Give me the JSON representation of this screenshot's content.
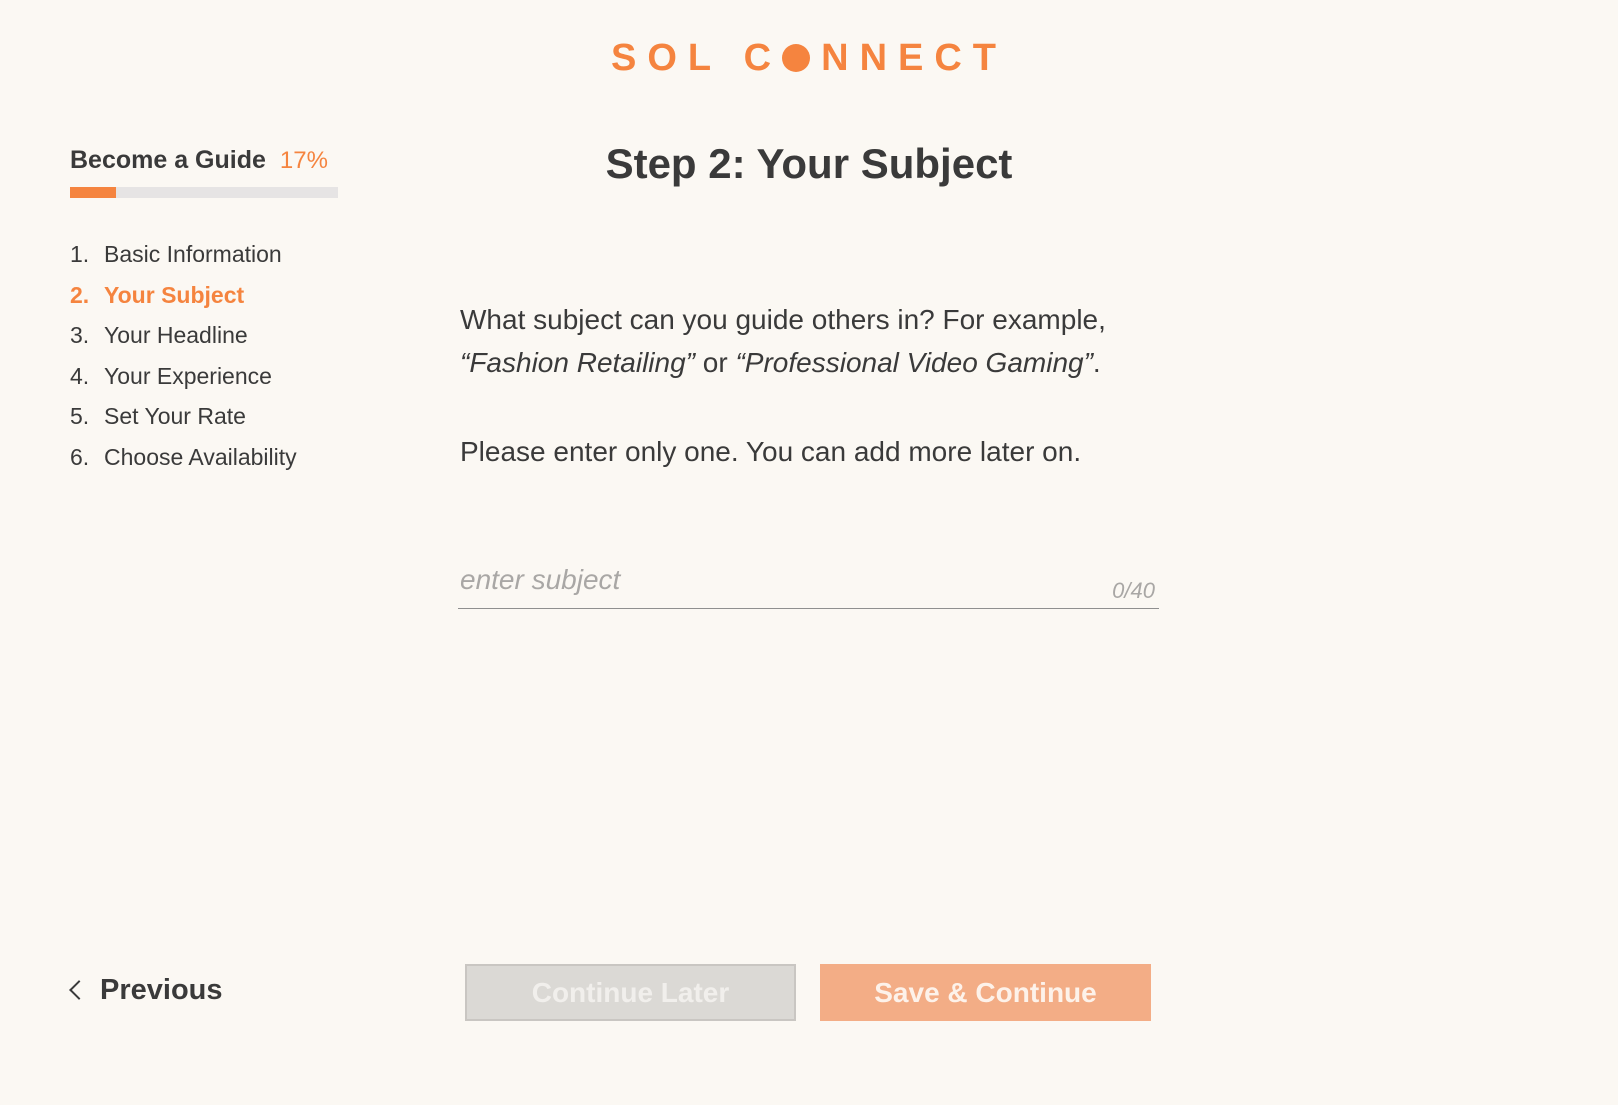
{
  "brand": {
    "logo_left": "SOL",
    "logo_c": "C",
    "logo_right": "NNECT",
    "accent_color": "#f5843f"
  },
  "sidebar": {
    "title": "Become a Guide",
    "percent_label": "17%",
    "progress_fraction": 0.17,
    "steps": [
      {
        "num": "1.",
        "label": "Basic Information"
      },
      {
        "num": "2.",
        "label": "Your Subject"
      },
      {
        "num": "3.",
        "label": "Your Headline"
      },
      {
        "num": "4.",
        "label": "Your Experience"
      },
      {
        "num": "5.",
        "label": "Set Your Rate"
      },
      {
        "num": "6.",
        "label": "Choose Availability"
      }
    ],
    "active_step_index": 1
  },
  "main": {
    "title": "Step 2: Your Subject",
    "prompt_line1": "What subject can you guide others in? For example,",
    "example_1": "“Fashion Retailing”",
    "connector": " or ",
    "example_2": "“Professional Video Gaming”",
    "prompt_end": ".",
    "prompt_2": "Please enter only one. You can add more later on.",
    "input": {
      "value": "",
      "placeholder": "enter subject",
      "counter": "0/40"
    }
  },
  "footer": {
    "previous_label": "Previous",
    "continue_later_label": "Continue Later",
    "save_continue_label": "Save & Continue"
  }
}
